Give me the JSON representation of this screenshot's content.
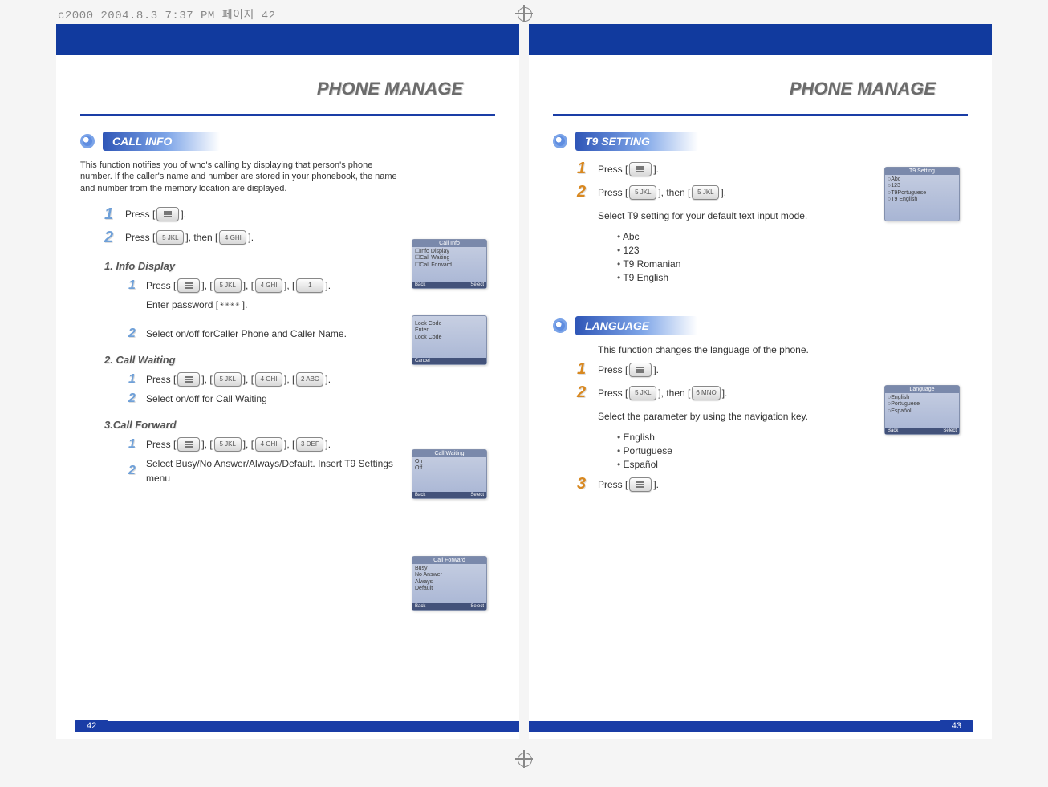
{
  "print_header": "c2000  2004.8.3 7:37 PM  페이지 42",
  "left": {
    "title": "PHONE MANAGE",
    "page_num": "42",
    "call_info": {
      "header": "CALL INFO",
      "intro": "This function notifies you of who's calling by displaying that person's phone number. If the caller's name and number are stored in your phonebook, the name and number from the memory location are displayed.",
      "step1": {
        "press": "Press [",
        "close": "]."
      },
      "step2": {
        "press": "Press [",
        "then": "], then [",
        "close": "].",
        "k1": "5 JKL",
        "k2": "4 GHI"
      },
      "thumb1": {
        "title": "Call Info",
        "l1": "☐Info Display",
        "l2": "☐Call Waiting",
        "l3": "☐Call Forward",
        "back": "Back",
        "select": "Select"
      },
      "sub1": {
        "heading": "1. Info Display",
        "s1": {
          "press": "Press  [",
          "seg": "],  [",
          "close": "].",
          "k1": "5 JKL",
          "k2": "4 GHI",
          "k3": "1"
        },
        "pw": {
          "pre": "Enter password [",
          "stars": "✳✳✳✳",
          "post": "]."
        },
        "thumb": {
          "title": "",
          "l1": "Lock Code",
          "l2": "Enter",
          "l3": "Lock Code",
          "cancel": "Cancel"
        },
        "s2": "Select on/off forCaller Phone and Caller Name."
      },
      "sub2": {
        "heading": "2. Call Waiting",
        "s1": {
          "press": "Press  [",
          "seg": "],  [",
          "close": "].",
          "k1": "5 JKL",
          "k2": "4 GHI",
          "k3": "2 ABC"
        },
        "thumb": {
          "title": "Call Waiting",
          "l1": "On",
          "l2": "Off",
          "back": "Back",
          "select": "Select"
        },
        "s2": "Select on/off for Call Waiting"
      },
      "sub3": {
        "heading": "3.Call Forward",
        "s1": {
          "press": "Press  [",
          "seg": "],  [",
          "close": "].",
          "k1": "5 JKL",
          "k2": "4 GHI",
          "k3": "3 DEF"
        },
        "thumb": {
          "title": "Call Forward",
          "l1": "Busy",
          "l2": "No Answer",
          "l3": "Always",
          "l4": "Default",
          "back": "Back",
          "select": "Select"
        },
        "s2": "Select  Busy/No Answer/Always/Default. Insert T9 Settings menu"
      }
    }
  },
  "right": {
    "title": "PHONE MANAGE",
    "page_num": "43",
    "t9": {
      "header": "T9 SETTING",
      "s1": {
        "press": "Press [",
        "close": "]."
      },
      "s2": {
        "press": "Press [",
        "then": "], then [",
        "close": "].",
        "k1": "5 JKL",
        "k2": "5 JKL"
      },
      "select_line": "Select T9 setting for your default text input mode.",
      "options": [
        "Abc",
        "123",
        "T9 Romanian",
        "T9 English"
      ],
      "thumb": {
        "title": "T9 Setting",
        "l1": "○Abc",
        "l2": "○123",
        "l3": "○T9Portuguese",
        "l4": "○T9 English"
      }
    },
    "lang": {
      "header": "LANGUAGE",
      "intro": "This function changes the language of the phone.",
      "s1": {
        "press": "Press [",
        "close": "]."
      },
      "s2": {
        "press": "Press  [",
        "then": "], then [",
        "close": "].",
        "k1": "5 JKL",
        "k2": "6 MNO"
      },
      "select_line": "Select the parameter by using the navigation key.",
      "options": [
        "English",
        "Portuguese",
        "Español"
      ],
      "s3": {
        "press": "Press [",
        "close": "]."
      },
      "thumb": {
        "title": "Language",
        "l1": "○English",
        "l2": "○Portuguese",
        "l3": "○Español",
        "back": "Back",
        "select": "Select"
      }
    }
  }
}
